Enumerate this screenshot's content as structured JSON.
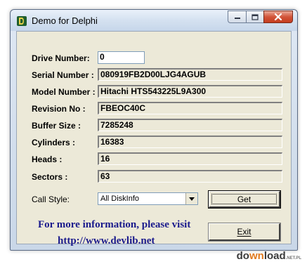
{
  "window": {
    "title": "Demo for Delphi",
    "controls": [
      "minimize",
      "maximize",
      "close"
    ]
  },
  "fields": [
    {
      "label": "Drive Number:",
      "value": "0"
    },
    {
      "label": "Serial Number :",
      "value": "080919FB2D00LJG4AGUB"
    },
    {
      "label": "Model Number :",
      "value": "Hitachi HTS543225L9A300"
    },
    {
      "label": "Revision No :",
      "value": "FBEOC40C"
    },
    {
      "label": "Buffer Size :",
      "value": "7285248"
    },
    {
      "label": "Cylinders :",
      "value": "16383"
    },
    {
      "label": "Heads :",
      "value": "16"
    },
    {
      "label": "Sectors :",
      "value": "63"
    }
  ],
  "call_style": {
    "label": "Call Style:",
    "selected": "All DiskInfo"
  },
  "buttons": {
    "get": "Get",
    "exit": "Exit"
  },
  "info": {
    "line1": "For more information, please visit",
    "line2": "http://www.devlib.net"
  },
  "watermark": {
    "prefix": "do",
    "accent": "wn",
    "rest": "load",
    "suffix": ".NET.PL"
  },
  "colors": {
    "info_text": "#1a1a8c",
    "client_bg": "#ece9d8",
    "close_button": "#c43c1f"
  }
}
